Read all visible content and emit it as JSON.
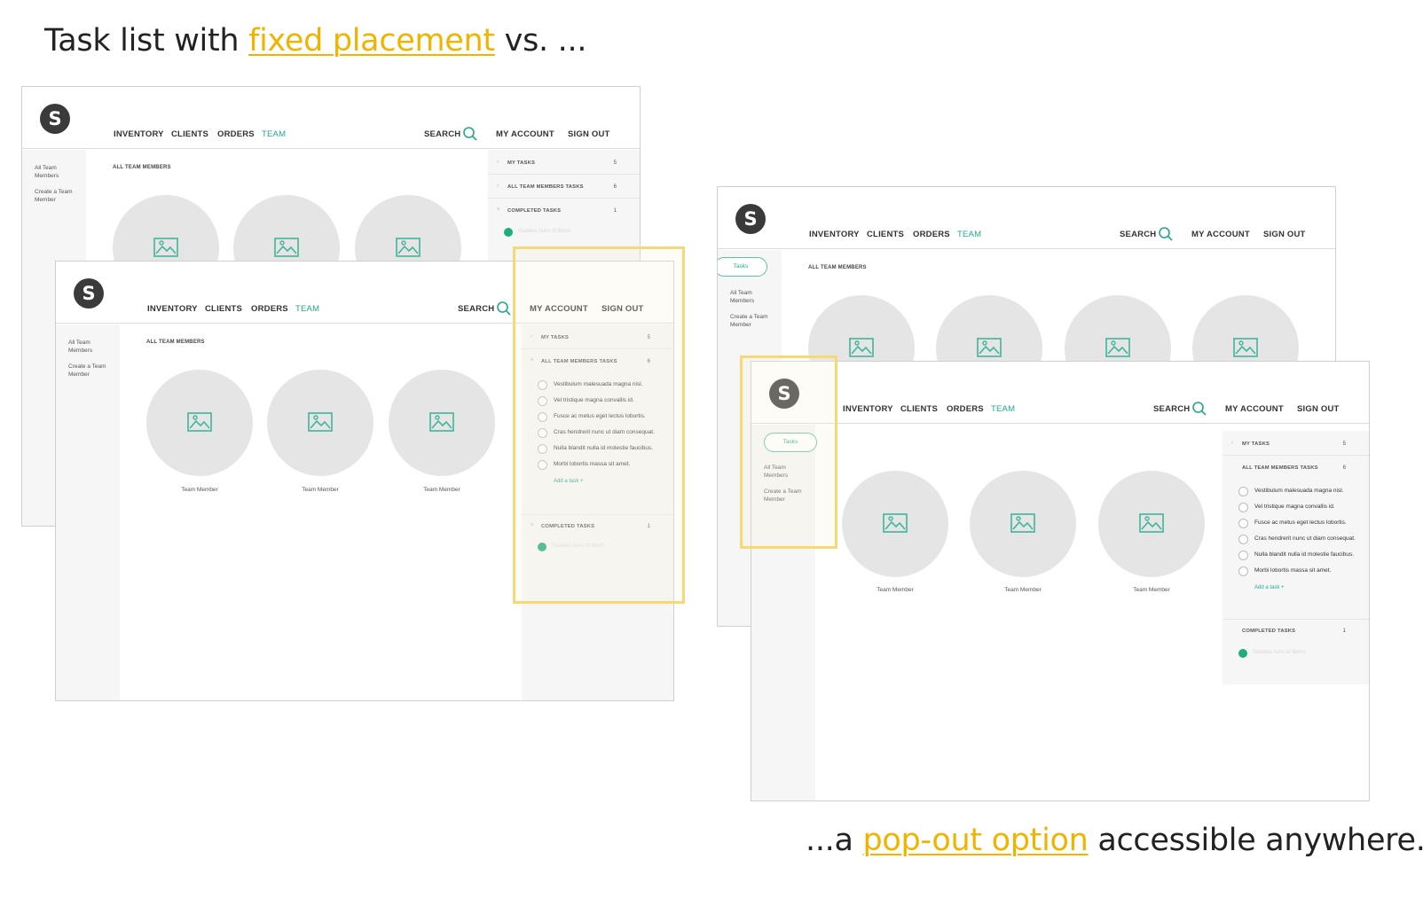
{
  "headline_top": {
    "before": "Task list with ",
    "highlight": "fixed placement",
    "after": " vs. ..."
  },
  "headline_bottom": {
    "before": "...a ",
    "highlight": "pop-out option",
    "after": " accessible anywhere."
  },
  "app": {
    "logo": "S",
    "nav": {
      "inventory": "INVENTORY",
      "clients": "CLIENTS",
      "orders": "ORDERS",
      "team": "TEAM"
    },
    "search": "SEARCH",
    "my_account": "MY ACCOUNT",
    "sign_out": "SIGN OUT",
    "sidebar": {
      "tasks_pill": "Tasks",
      "all_members": "All Team Members",
      "create_member": "Create a Team Member"
    },
    "section_title": "ALL TEAM MEMBERS",
    "member_label": "Team Member",
    "tasks": {
      "my_tasks": "MY TASKS",
      "my_tasks_count": "5",
      "all_tasks": "ALL TEAM MEMBERS TASKS",
      "all_tasks_count": "6",
      "completed": "COMPLETED TASKS",
      "completed_count": "1",
      "items": [
        "Vestibulum malesuada magna nisl.",
        "Vel tristique magna convallis id.",
        "Fusce ac metus eget lectus lobortis.",
        "Cras hendrerit nunc ut diam consequat.",
        "Nulla blandit nulla id molestie faucibus.",
        "Morbi lobortis massa sit amet."
      ],
      "add_task": "Add a task +",
      "completed_item": "Sodales nunc id libero"
    }
  },
  "colors": {
    "accent": "#22a98a",
    "highlight": "#f0b400",
    "frame": "#f7d877",
    "panel": "#f6f6f6"
  },
  "icons": {
    "search": "search-icon",
    "image": "image-placeholder-icon",
    "task_status": "circle-checkbox-icon",
    "completed": "completed-dot-icon"
  }
}
